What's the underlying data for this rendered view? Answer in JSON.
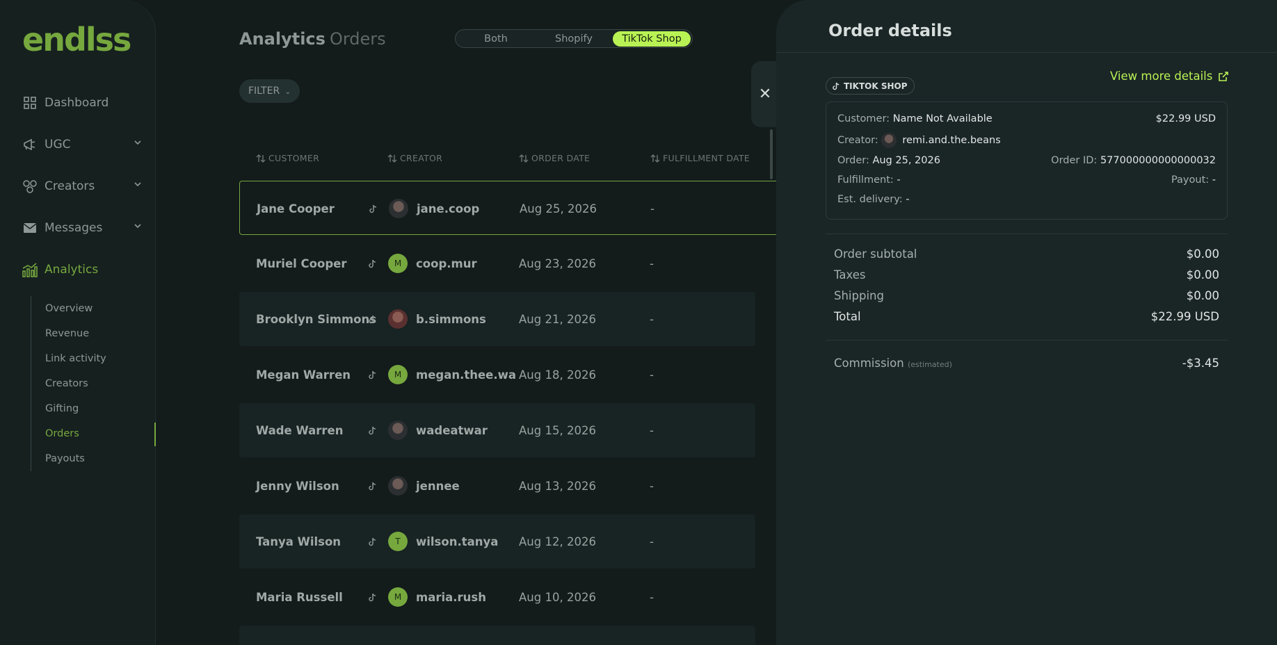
{
  "brand": "endlss",
  "nav": {
    "dashboard": "Dashboard",
    "ugc": "UGC",
    "creators": "Creators",
    "messages": "Messages",
    "analytics": "Analytics",
    "sub": [
      "Overview",
      "Revenue",
      "Link activity",
      "Creators",
      "Gifting",
      "Orders",
      "Payouts"
    ]
  },
  "header": {
    "title": "Analytics",
    "subtitle": "Orders"
  },
  "platform_toggle": {
    "options": [
      "Both",
      "Shopify",
      "TikTok Shop"
    ],
    "selected": "TikTok Shop"
  },
  "filter_label": "FILTER",
  "table": {
    "columns": [
      "CUSTOMER",
      "CREATOR",
      "ORDER DATE",
      "FULFILLMENT DATE"
    ],
    "rows": [
      {
        "customer": "Jane Cooper",
        "creator": "jane.coop",
        "avatar": "",
        "date": "Aug 25, 2026",
        "fulfillment": "-"
      },
      {
        "customer": "Muriel Cooper",
        "creator": "coop.mur",
        "avatar": "M",
        "date": "Aug 23, 2026",
        "fulfillment": "-"
      },
      {
        "customer": "Brooklyn Simmons",
        "creator": "b.simmons",
        "avatar": "",
        "date": "Aug 21, 2026",
        "fulfillment": "-"
      },
      {
        "customer": "Megan Warren",
        "creator": "megan.thee.wa",
        "avatar": "M",
        "date": "Aug 18, 2026",
        "fulfillment": "-"
      },
      {
        "customer": "Wade Warren",
        "creator": "wadeatwar",
        "avatar": "",
        "date": "Aug 15, 2026",
        "fulfillment": "-"
      },
      {
        "customer": "Jenny Wilson",
        "creator": "jennee",
        "avatar": "",
        "date": "Aug 13, 2026",
        "fulfillment": "-"
      },
      {
        "customer": "Tanya Wilson",
        "creator": "wilson.tanya",
        "avatar": "T",
        "date": "Aug 12, 2026",
        "fulfillment": "-"
      },
      {
        "customer": "Maria Russell",
        "creator": "maria.rush",
        "avatar": "M",
        "date": "Aug 10, 2026",
        "fulfillment": "-"
      }
    ]
  },
  "panel": {
    "title": "Order details",
    "badge": "TIKTOK SHOP",
    "view_more": "View more details",
    "customer_label": "Customer:",
    "customer_value": "Name Not Available",
    "amount": "$22.99 USD",
    "creator_label": "Creator:",
    "creator_value": "remi.and.the.beans",
    "order_label": "Order:",
    "order_value": "Aug 25, 2026",
    "order_id_label": "Order ID:",
    "order_id_value": "577000000000000032",
    "fulfillment_label": "Fulfillment:",
    "fulfillment_value": "-",
    "payout_label": "Payout:",
    "payout_value": "-",
    "delivery_label": "Est. delivery:",
    "delivery_value": "-",
    "summary": [
      {
        "label": "Order subtotal",
        "value": "$0.00"
      },
      {
        "label": "Taxes",
        "value": "$0.00"
      },
      {
        "label": "Shipping",
        "value": "$0.00"
      },
      {
        "label": "Total",
        "value": "$22.99 USD"
      }
    ],
    "commission_label": "Commission",
    "commission_note": "(estimated)",
    "commission_value": "-$3.45"
  },
  "colors": {
    "accent": "#76a83e",
    "highlight": "#b9f254",
    "background": "#131b1b",
    "panel": "#1a2526"
  }
}
